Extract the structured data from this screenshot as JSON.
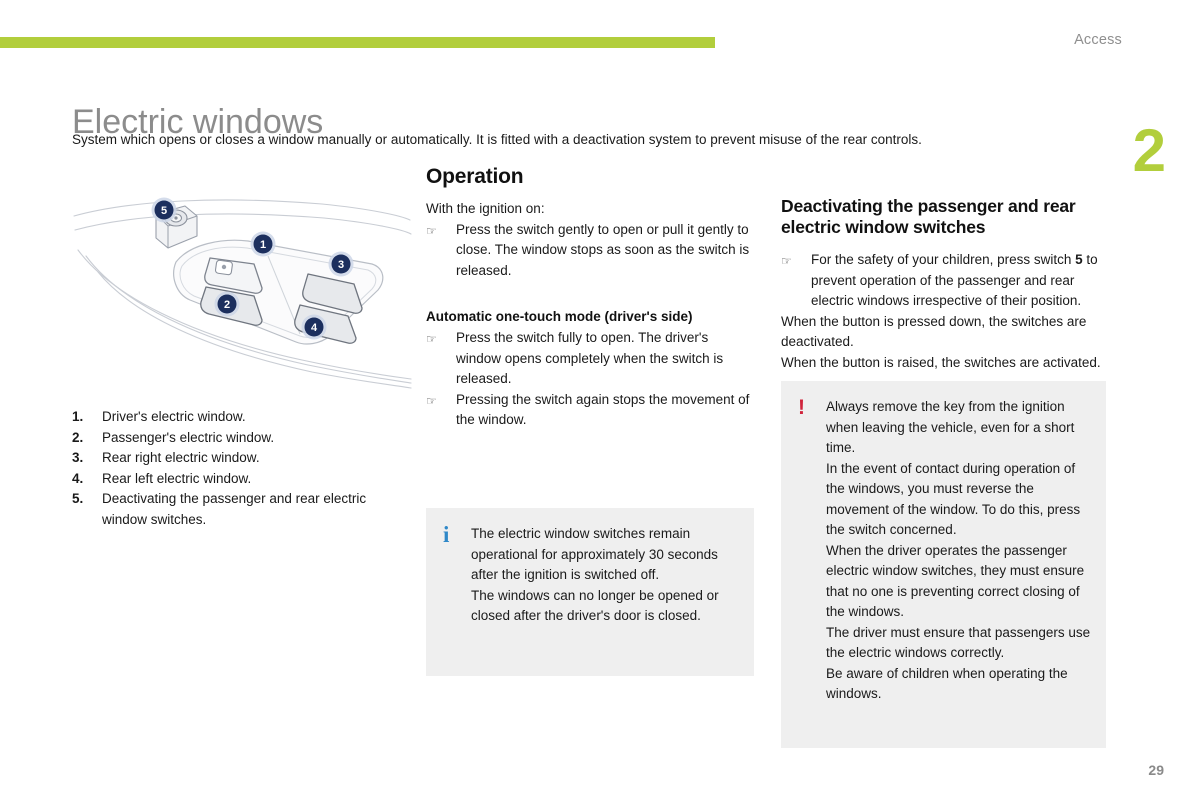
{
  "header": {
    "section_label": "Access",
    "chapter_number": "2",
    "accent_color": "#b2ce3c"
  },
  "title": {
    "heading": "Electric windows",
    "subtitle": "System which opens or closes a window manually or automatically. It is fitted with a deactivation system to prevent misuse of the rear controls."
  },
  "illustration": {
    "alt": "Driver door armrest with electric window switches",
    "callouts": [
      {
        "id": "1",
        "label": "1"
      },
      {
        "id": "2",
        "label": "2"
      },
      {
        "id": "3",
        "label": "3"
      },
      {
        "id": "4",
        "label": "4"
      },
      {
        "id": "5",
        "label": "5"
      }
    ],
    "badge_color": "#1c2f5e",
    "badge_ring_color": "#ccd6e8"
  },
  "legend": [
    {
      "num": "1.",
      "text": "Driver's electric window."
    },
    {
      "num": "2.",
      "text": "Passenger's electric window."
    },
    {
      "num": "3.",
      "text": "Rear right electric window."
    },
    {
      "num": "4.",
      "text": "Rear left electric window."
    },
    {
      "num": "5.",
      "text": "Deactivating the passenger and rear electric window switches."
    }
  ],
  "operation": {
    "heading": "Operation",
    "intro": "With the ignition on:",
    "bullet_glyph": "☞",
    "bullets": [
      "Press the switch gently to open or pull it gently to close. The window stops as soon as the switch is released."
    ],
    "auto_heading": "Automatic one-touch mode (driver's side)",
    "auto_bullets": [
      "Press the switch fully to open. The driver's window opens completely when the switch is released.",
      "Pressing the switch again stops the movement of the window."
    ]
  },
  "deactivating": {
    "heading": "Deactivating the passenger and rear electric window switches",
    "bullet_prefix": "For the safety of your children, press switch ",
    "bullet_bold": "5",
    "bullet_suffix": " to prevent operation of the passenger and rear electric windows irrespective of their position.",
    "lines": [
      "When the button is pressed down, the switches are deactivated.",
      "When the button is raised, the switches are activated."
    ]
  },
  "info_box": {
    "icon": "info-icon",
    "icon_glyph": "i",
    "icon_color": "#2f88c8",
    "background": "#efefef",
    "paragraphs": [
      "The electric window switches remain operational for approximately 30 seconds after the ignition is switched off.",
      "The windows can no longer be opened or closed after the driver's door is closed."
    ]
  },
  "warning_box": {
    "icon": "warning-icon",
    "icon_glyph": "!",
    "icon_color": "#d0243c",
    "background": "#efefef",
    "paragraphs": [
      "Always remove the key from the ignition when leaving the vehicle, even for a short time.",
      "In the event of contact during operation of the windows, you must reverse the movement of the window. To do this, press the switch concerned.",
      "When the driver operates the passenger electric window switches, they must ensure that no one is preventing correct closing of the windows.",
      "The driver must ensure that passengers use the electric windows correctly.",
      "Be aware of children when operating the windows."
    ]
  },
  "footer": {
    "page_number": "29"
  }
}
